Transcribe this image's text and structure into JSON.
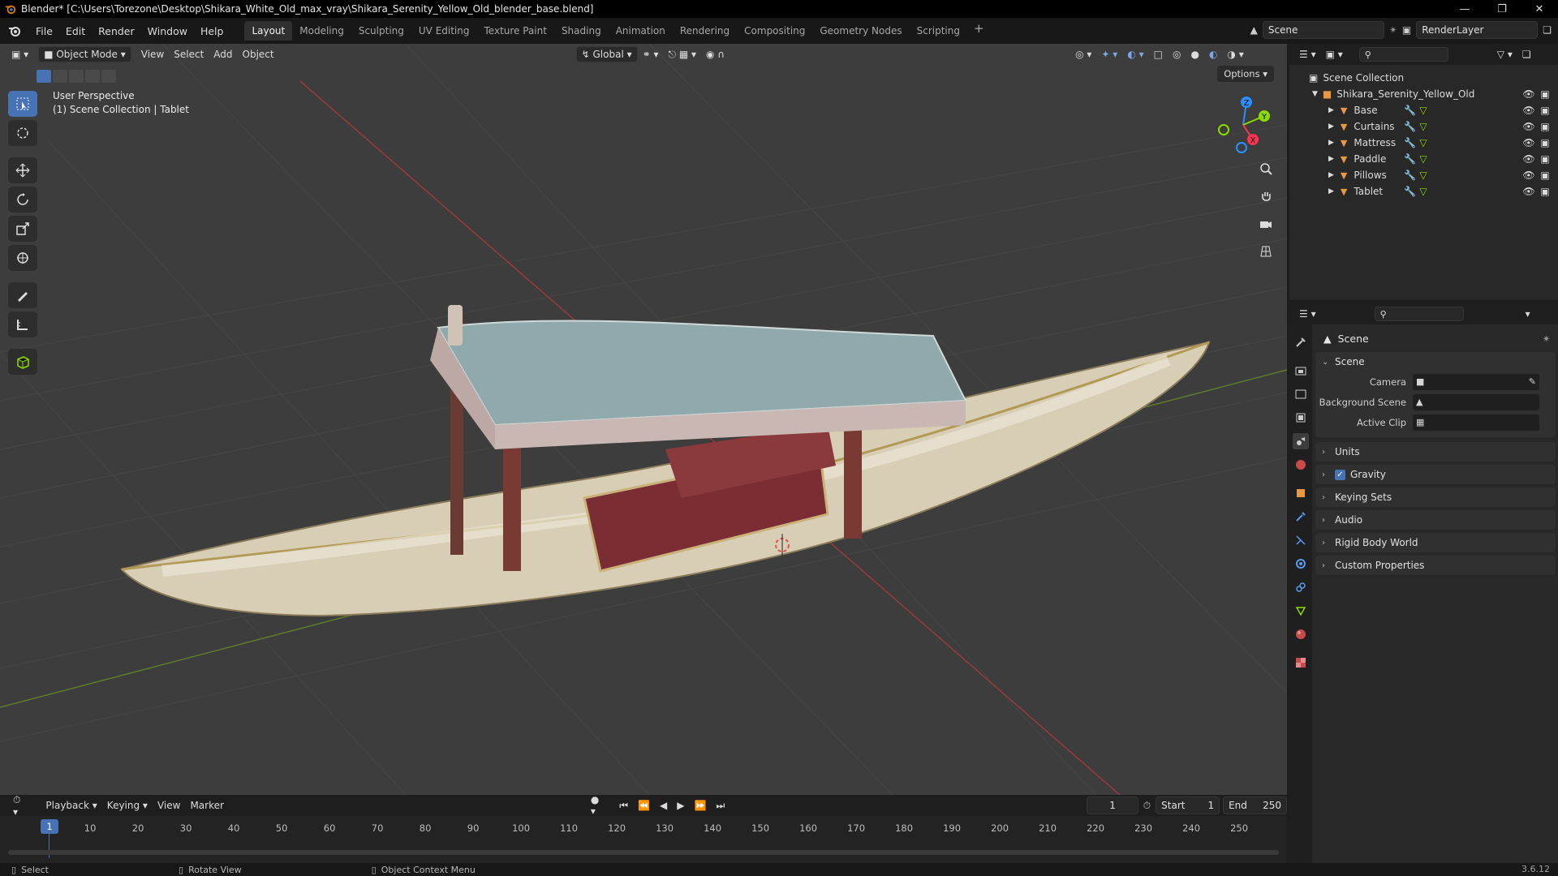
{
  "window": {
    "title": "Blender* [C:\\Users\\Torezone\\Desktop\\Shikara_White_Old_max_vray\\Shikara_Serenity_Yellow_Old_blender_base.blend]"
  },
  "menu": {
    "items": [
      "File",
      "Edit",
      "Render",
      "Window",
      "Help"
    ]
  },
  "workspaces": [
    "Layout",
    "Modeling",
    "Sculpting",
    "UV Editing",
    "Texture Paint",
    "Shading",
    "Animation",
    "Rendering",
    "Compositing",
    "Geometry Nodes",
    "Scripting"
  ],
  "active_workspace": "Layout",
  "scene_selector": {
    "scene": "Scene",
    "view_layer": "RenderLayer"
  },
  "viewport_header": {
    "mode": "Object Mode",
    "menus": [
      "View",
      "Select",
      "Add",
      "Object"
    ],
    "orientation": "Global",
    "options_label": "Options"
  },
  "viewport": {
    "perspective_label": "User Perspective",
    "collection_label": "(1) Scene Collection | Tablet",
    "gizmo_axes": [
      "X",
      "Y",
      "Z"
    ]
  },
  "timeline": {
    "menus": [
      "Playback",
      "Keying",
      "View",
      "Marker"
    ],
    "current_frame": "1",
    "start_label": "Start",
    "start": "1",
    "end_label": "End",
    "end": "250",
    "ticks": [
      "1",
      "10",
      "20",
      "30",
      "40",
      "50",
      "60",
      "70",
      "80",
      "90",
      "100",
      "110",
      "120",
      "130",
      "140",
      "150",
      "160",
      "170",
      "180",
      "190",
      "200",
      "210",
      "220",
      "230",
      "240",
      "250"
    ]
  },
  "statusbar": {
    "select": "Select",
    "rotate": "Rotate View",
    "context": "Object Context Menu",
    "version": "3.6.12"
  },
  "outliner": {
    "root": "Scene Collection",
    "collection": "Shikara_Serenity_Yellow_Old",
    "objects": [
      "Base",
      "Curtains",
      "Mattress",
      "Paddle",
      "Pillows",
      "Tablet"
    ]
  },
  "properties": {
    "context_title": "Scene",
    "scene_panel": "Scene",
    "camera_label": "Camera",
    "background_scene_label": "Background Scene",
    "active_clip_label": "Active Clip",
    "panels": [
      "Units",
      "Gravity",
      "Keying Sets",
      "Audio",
      "Rigid Body World",
      "Custom Properties"
    ]
  },
  "colors": {
    "accent": "#4772b3",
    "viewport_bg": "#3d3d3d",
    "axis_x": "#ff3352",
    "axis_y": "#8bdc00",
    "axis_z": "#2890ff",
    "object_icon": "#e89744"
  }
}
